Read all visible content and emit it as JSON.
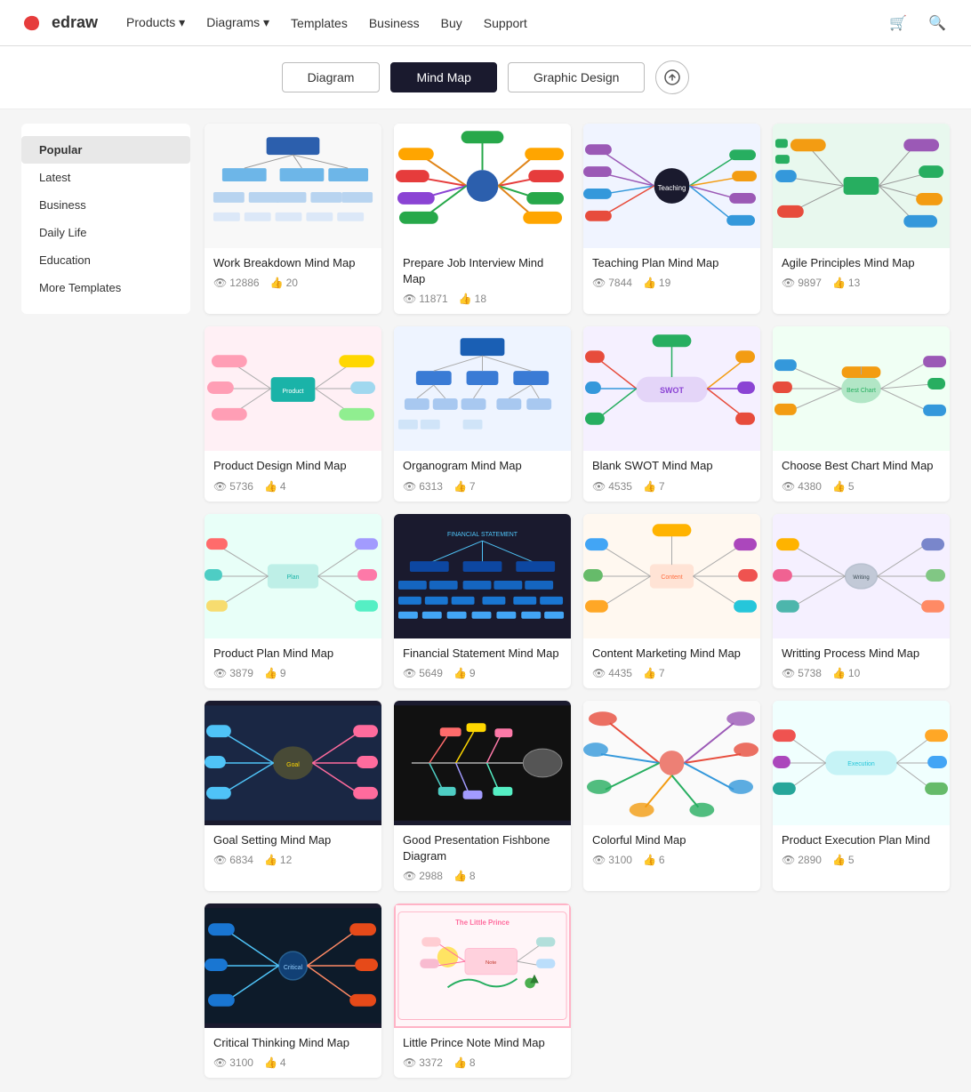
{
  "nav": {
    "logo": "edraw",
    "links": [
      {
        "label": "Products",
        "hasArrow": true
      },
      {
        "label": "Diagrams",
        "hasArrow": true
      },
      {
        "label": "Templates",
        "hasArrow": false
      },
      {
        "label": "Business",
        "hasArrow": false
      },
      {
        "label": "Buy",
        "hasArrow": false
      },
      {
        "label": "Support",
        "hasArrow": false
      }
    ]
  },
  "toolbar": {
    "tabs": [
      {
        "label": "Diagram",
        "active": false
      },
      {
        "label": "Mind Map",
        "active": true
      },
      {
        "label": "Graphic Design",
        "active": false
      }
    ],
    "upload_label": "↑"
  },
  "sidebar": {
    "items": [
      {
        "label": "Popular",
        "active": true
      },
      {
        "label": "Latest",
        "active": false
      },
      {
        "label": "Business",
        "active": false
      },
      {
        "label": "Daily Life",
        "active": false
      },
      {
        "label": "Education",
        "active": false
      },
      {
        "label": "More Templates",
        "active": false
      }
    ]
  },
  "cards": [
    {
      "id": "work-breakdown",
      "title": "Work Breakdown Mind Map",
      "views": "12886",
      "likes": "20",
      "bg": "light",
      "color": "blue"
    },
    {
      "id": "prepare-job",
      "title": "Prepare Job Interview Mind Map",
      "views": "11871",
      "likes": "18",
      "bg": "light",
      "color": "mixed"
    },
    {
      "id": "teaching-plan",
      "title": "Teaching Plan Mind Map",
      "views": "7844",
      "likes": "19",
      "bg": "light",
      "color": "dark"
    },
    {
      "id": "agile-principles",
      "title": "Agile Principles Mind Map",
      "views": "9897",
      "likes": "13",
      "bg": "light",
      "color": "green"
    },
    {
      "id": "product-design",
      "title": "Product Design Mind Map",
      "views": "5736",
      "likes": "4",
      "bg": "light",
      "color": "pink"
    },
    {
      "id": "organogram",
      "title": "Organogram Mind Map",
      "views": "6313",
      "likes": "7",
      "bg": "light",
      "color": "blue"
    },
    {
      "id": "blank-swot",
      "title": "Blank SWOT Mind Map",
      "views": "4535",
      "likes": "7",
      "bg": "light",
      "color": "purple"
    },
    {
      "id": "choose-best-chart",
      "title": "Choose Best Chart Mind Map",
      "views": "4380",
      "likes": "5",
      "bg": "light",
      "color": "green"
    },
    {
      "id": "writing-process",
      "title": "Writting Process Mind Map",
      "views": "5738",
      "likes": "10",
      "bg": "light",
      "color": "gray"
    },
    {
      "id": "product-plan",
      "title": "Product Plan Mind Map",
      "views": "3879",
      "likes": "9",
      "bg": "light",
      "color": "teal"
    },
    {
      "id": "financial-statement",
      "title": "Financial Statement Mind Map",
      "views": "5649",
      "likes": "9",
      "bg": "dark",
      "color": "white"
    },
    {
      "id": "content-marketing",
      "title": "Content Marketing Mind Map",
      "views": "4435",
      "likes": "7",
      "bg": "light",
      "color": "orange"
    },
    {
      "id": "goal-setting",
      "title": "Goal Setting Mind Map",
      "views": "6834",
      "likes": "12",
      "bg": "dark",
      "color": "blue"
    },
    {
      "id": "good-presentation",
      "title": "Good Presentation Fishbone Diagram",
      "views": "2988",
      "likes": "8",
      "bg": "dark",
      "color": "white"
    },
    {
      "id": "colorful",
      "title": "Colorful Mind Map",
      "views": "3100",
      "likes": "6",
      "bg": "light",
      "color": "multi"
    },
    {
      "id": "product-execution",
      "title": "Product Execution Plan Mind",
      "views": "2890",
      "likes": "5",
      "bg": "light",
      "color": "teal"
    },
    {
      "id": "critical-thinking",
      "title": "Critical Thinking Mind Map",
      "views": "3100",
      "likes": "4",
      "bg": "dark",
      "color": "blue"
    },
    {
      "id": "little-prince",
      "title": "Little Prince Note Mind Map",
      "views": "3372",
      "likes": "8",
      "bg": "light",
      "color": "pink"
    }
  ]
}
